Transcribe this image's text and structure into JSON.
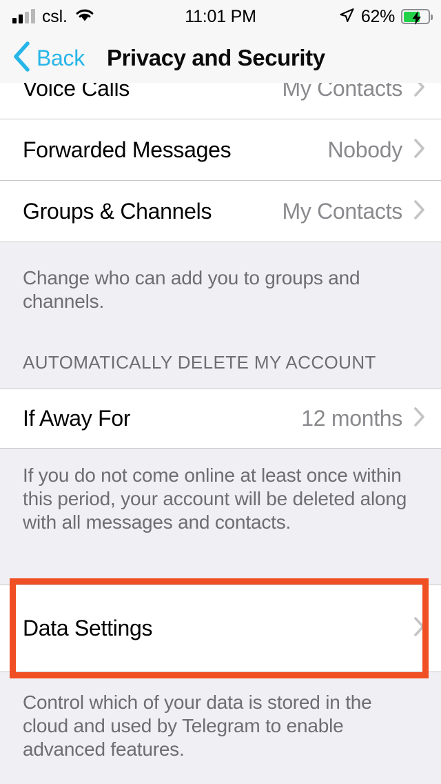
{
  "status_bar": {
    "carrier": "csl.",
    "time": "11:01 PM",
    "battery_percent": "62%",
    "signal_icon": "signal-bars-icon",
    "wifi_icon": "wifi-icon",
    "location_icon": "location-arrow-icon",
    "battery_icon": "battery-charging-icon",
    "battery_level": 62,
    "battery_charging": true
  },
  "nav": {
    "back_label": "Back",
    "title": "Privacy and Security",
    "back_icon": "chevron-left-icon",
    "accent_color": "#27b6e8"
  },
  "rows": {
    "voice_calls": {
      "title": "Voice Calls",
      "value": "My Contacts"
    },
    "forwarded_messages": {
      "title": "Forwarded Messages",
      "value": "Nobody"
    },
    "groups_channels": {
      "title": "Groups & Channels",
      "value": "My Contacts"
    },
    "if_away_for": {
      "title": "If Away For",
      "value": "12 months"
    },
    "data_settings": {
      "title": "Data Settings",
      "value": ""
    }
  },
  "footers": {
    "groups": "Change who can add you to groups and channels.",
    "auto_delete": "If you do not come online at least once within this period, your account will be deleted along with all messages and contacts.",
    "data": "Control which of your data is stored in the cloud and used by Telegram to enable advanced features."
  },
  "sections": {
    "auto_delete_header": "AUTOMATICALLY DELETE MY ACCOUNT"
  },
  "highlight": {
    "target": "data_settings",
    "color": "#f04e23"
  }
}
